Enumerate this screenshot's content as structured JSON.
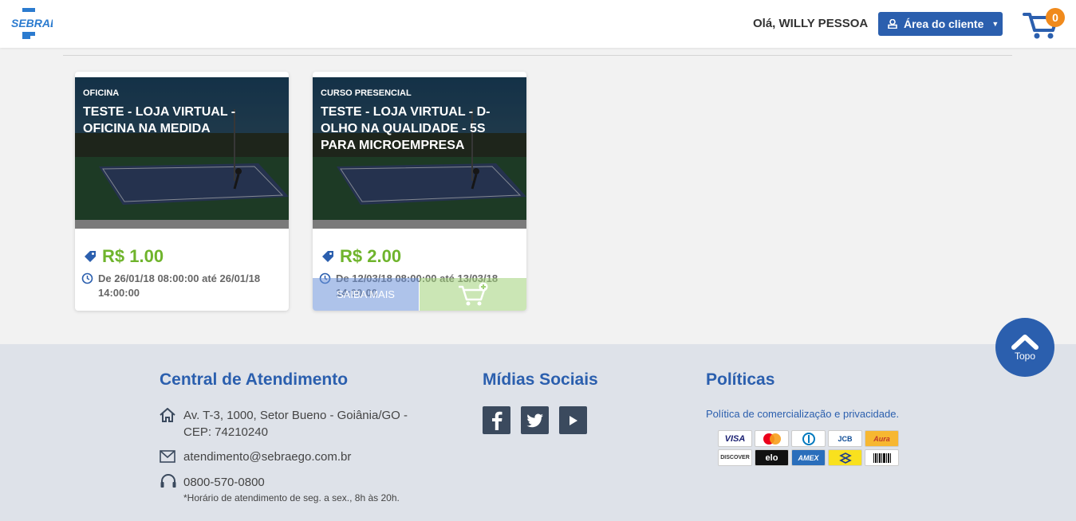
{
  "header": {
    "logo_text": "SEBRAE",
    "greeting": "Olá, WILLY PESSOA",
    "client_area_label": "Área do cliente",
    "cart_count": "0"
  },
  "products": [
    {
      "type": "OFICINA",
      "title": "TESTE - LOJA VIRTUAL - OFICINA NA MEDIDA",
      "price": "R$ 1.00",
      "date": "De 26/01/18 08:00:00 até 26/01/18 14:00:00"
    },
    {
      "type": "CURSO PRESENCIAL",
      "title": "TESTE - LOJA VIRTUAL - D-OLHO NA QUALIDADE - 5S PARA MICROEMPRESA",
      "price": "R$ 2.00",
      "date": "De 12/03/18 08:00:00 até 13/03/18 14:00:00",
      "saiba_mais": "SAIBA MAIS"
    }
  ],
  "footer": {
    "central_title": "Central de Atendimento",
    "address": "Av. T-3, 1000, Setor Bueno - Goiânia/GO - CEP: 74210240",
    "email": "atendimento@sebraego.com.br",
    "phone": "0800-570-0800",
    "hours_note": "*Horário de atendimento de seg. a sex., 8h às 20h.",
    "social_title": "Mídias Sociais",
    "policies_title": "Políticas",
    "policy_link": "Política de comercialização e privacidade.",
    "payment_methods": [
      "VISA",
      "mastercard",
      "diners",
      "JCB",
      "Aura",
      "DISCOVER",
      "elo",
      "AMEX",
      "banco-do-brasil",
      "boleto"
    ]
  },
  "topo_label": "Topo",
  "colors": {
    "brand_blue": "#2b5fae",
    "price_green": "#6fb42c",
    "badge_orange": "#f08a1c"
  }
}
